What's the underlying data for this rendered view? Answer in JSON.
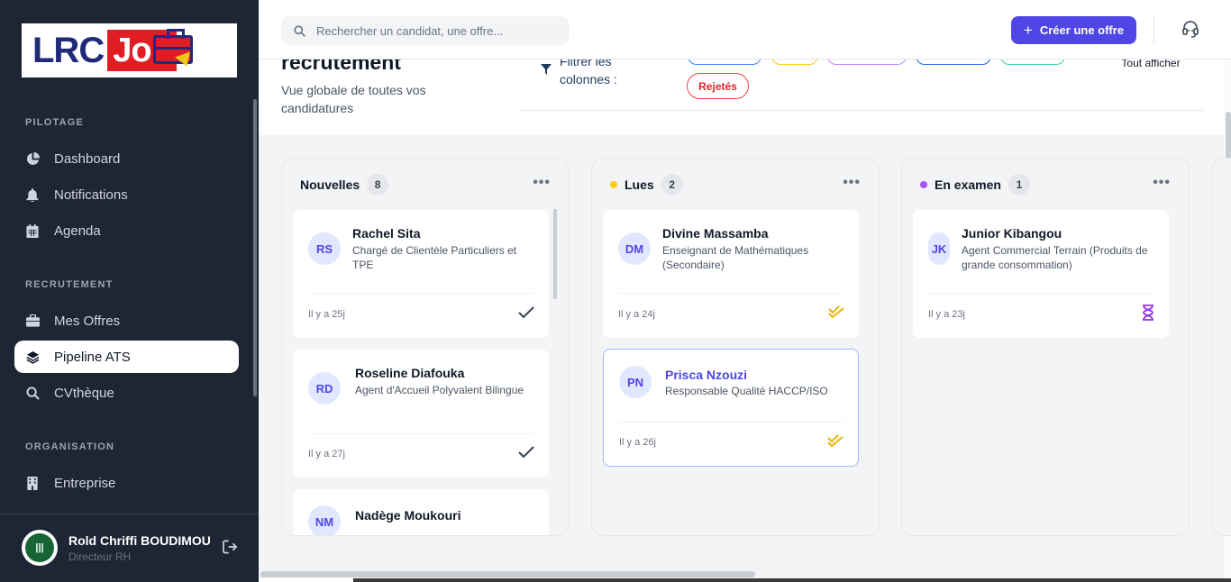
{
  "logo": {
    "part1": "LRC",
    "part2": "Job"
  },
  "sidebar": {
    "sections": [
      {
        "title": "PILOTAGE",
        "items": [
          {
            "label": "Dashboard",
            "icon": "pie-chart-icon"
          },
          {
            "label": "Notifications",
            "icon": "bell-icon"
          },
          {
            "label": "Agenda",
            "icon": "calendar-icon"
          }
        ]
      },
      {
        "title": "RECRUTEMENT",
        "items": [
          {
            "label": "Mes Offres",
            "icon": "briefcase-icon"
          },
          {
            "label": "Pipeline ATS",
            "icon": "layers-icon",
            "active": true
          },
          {
            "label": "CVthèque",
            "icon": "search-icon"
          }
        ]
      },
      {
        "title": "ORGANISATION",
        "items": [
          {
            "label": "Entreprise",
            "icon": "building-icon"
          }
        ]
      }
    ],
    "user": {
      "name": "Rold Chriffi BOUDIMOU",
      "role": "Directeur RH"
    }
  },
  "topbar": {
    "search_placeholder": "Rechercher un candidat, une offre...",
    "create_label": "Créer une offre"
  },
  "header": {
    "title": "recrutement",
    "subtitle": "Vue globale de toutes vos candidatures",
    "filter_label": "Filtrer les colonnes :",
    "chip_rejetes": "Rejetés",
    "show_all": "Tout afficher"
  },
  "columns": [
    {
      "title": "Nouvelles",
      "count": "8",
      "dot_color": "",
      "cards": [
        {
          "initials": "RS",
          "name": "Rachel Sita",
          "job": "Chargé de Clientèle Particuliers et TPE",
          "time": "Il y a 25j",
          "status": "check-icon"
        },
        {
          "initials": "RD",
          "name": "Roseline Diafouka",
          "job": "Agent d'Accueil Polyvalent Bilingue",
          "time": "Il y a 27j",
          "status": "check-icon"
        },
        {
          "initials": "NM",
          "name": "Nadège Moukouri",
          "job": "",
          "time": "",
          "status": ""
        }
      ]
    },
    {
      "title": "Lues",
      "count": "2",
      "dot_color": "#facc15",
      "cards": [
        {
          "initials": "DM",
          "name": "Divine Massamba",
          "job": "Enseignant de Mathématiques (Secondaire)",
          "time": "Il y a 24j",
          "status": "double-check-icon"
        },
        {
          "initials": "PN",
          "name": "Prisca Nzouzi",
          "job": "Responsable Qualité HACCP/ISO",
          "time": "Il y a 26j",
          "status": "double-check-icon"
        }
      ]
    },
    {
      "title": "En examen",
      "count": "1",
      "dot_color": "#a855f7",
      "cards": [
        {
          "initials": "JK",
          "name": "Junior Kibangou",
          "job": "Agent Commercial Terrain (Produits de grande consommation)",
          "time": "Il y a 23j",
          "status": "hourglass-icon"
        }
      ]
    }
  ],
  "colors": {
    "accent": "#4f46e5",
    "sidebar": "#1e2535",
    "reject": "#ef4444"
  }
}
